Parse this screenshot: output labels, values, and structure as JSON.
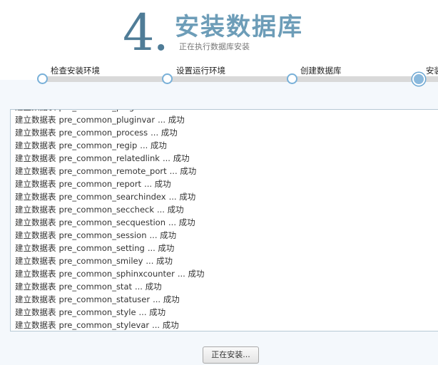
{
  "header": {
    "step_number": "4.",
    "title": "安装数据库",
    "subtitle": "正在执行数据库安装"
  },
  "steps": [
    {
      "label": "检查安装环境",
      "state": "done"
    },
    {
      "label": "设置运行环境",
      "state": "done"
    },
    {
      "label": "创建数据库",
      "state": "done"
    },
    {
      "label": "安装",
      "state": "active"
    }
  ],
  "log": {
    "prefix": "建立数据表",
    "status": "... 成功",
    "entries": [
      {
        "table": "pre_common_plugin",
        "status": ""
      },
      {
        "table": "pre_common_pluginvar",
        "status": "... 成功"
      },
      {
        "table": "pre_common_process",
        "status": "... 成功"
      },
      {
        "table": "pre_common_regip",
        "status": "... 成功"
      },
      {
        "table": "pre_common_relatedlink",
        "status": "... 成功"
      },
      {
        "table": "pre_common_remote_port",
        "status": "... 成功"
      },
      {
        "table": "pre_common_report",
        "status": "... 成功"
      },
      {
        "table": "pre_common_searchindex",
        "status": "... 成功"
      },
      {
        "table": "pre_common_seccheck",
        "status": "... 成功"
      },
      {
        "table": "pre_common_secquestion",
        "status": "... 成功"
      },
      {
        "table": "pre_common_session",
        "status": "... 成功"
      },
      {
        "table": "pre_common_setting",
        "status": "... 成功"
      },
      {
        "table": "pre_common_smiley",
        "status": "... 成功"
      },
      {
        "table": "pre_common_sphinxcounter",
        "status": "... 成功"
      },
      {
        "table": "pre_common_stat",
        "status": "... 成功"
      },
      {
        "table": "pre_common_statuser",
        "status": "... 成功"
      },
      {
        "table": "pre_common_style",
        "status": "... 成功"
      },
      {
        "table": "pre_common_stylevar",
        "status": "... 成功"
      }
    ]
  },
  "button": {
    "label": "正在安装..."
  },
  "colors": {
    "accent": "#6d9db8",
    "step_number": "#4f7c97",
    "progress_dot": "#78b0d8"
  }
}
